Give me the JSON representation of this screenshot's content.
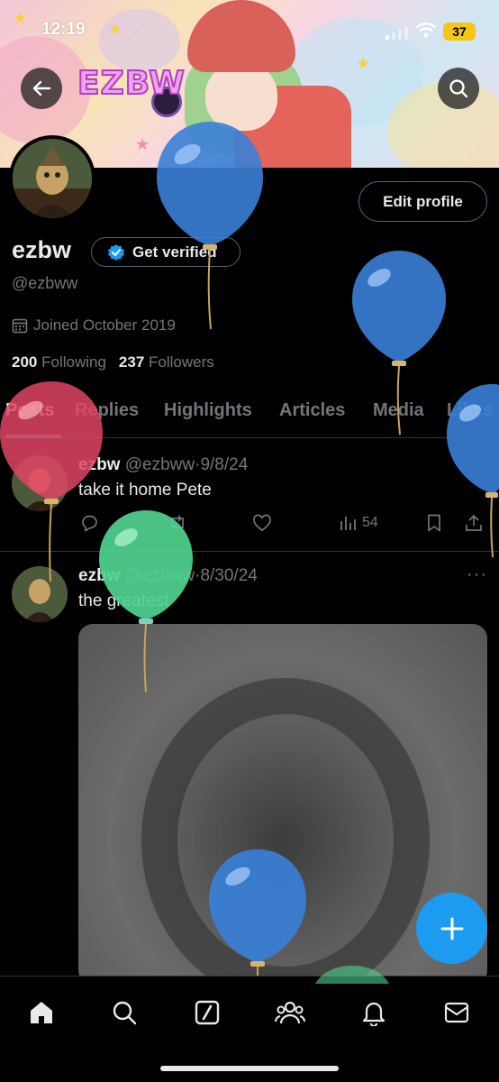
{
  "status_bar": {
    "time": "12:19",
    "battery": "37"
  },
  "banner": {
    "logo_text": "EZBW"
  },
  "profile": {
    "display_name": "ezbw",
    "verify_label": "Get verified",
    "handle": "@ezbww",
    "joined": "Joined October 2019",
    "following_count": "200",
    "following_label": "Following",
    "followers_count": "237",
    "followers_label": "Followers",
    "edit_label": "Edit profile"
  },
  "tabs": [
    {
      "label": "Posts",
      "active": true
    },
    {
      "label": "Replies"
    },
    {
      "label": "Highlights"
    },
    {
      "label": "Articles"
    },
    {
      "label": "Media"
    },
    {
      "label": "Likes"
    }
  ],
  "posts": [
    {
      "name": "ezbw",
      "handle": "@ezbww",
      "sep": "·",
      "date": "9/8/24",
      "text": "take it home Pete",
      "views": "54"
    },
    {
      "name": "ezbw",
      "handle": "@ezbww",
      "sep": "·",
      "date": "8/30/24",
      "text": "the greatest",
      "more": "···"
    }
  ],
  "colors": {
    "accent": "#1d9bf0",
    "background": "#000000",
    "muted": "#71767b",
    "text": "#e7e9ea",
    "border": "#2f3336"
  },
  "icons": [
    "back-arrow-icon",
    "search-icon",
    "verified-badge-icon",
    "calendar-icon",
    "reply-icon",
    "repost-icon",
    "like-icon",
    "views-icon",
    "bookmark-icon",
    "share-icon",
    "plus-icon",
    "home-icon",
    "grok-icon",
    "communities-icon",
    "notifications-icon",
    "messages-icon"
  ]
}
